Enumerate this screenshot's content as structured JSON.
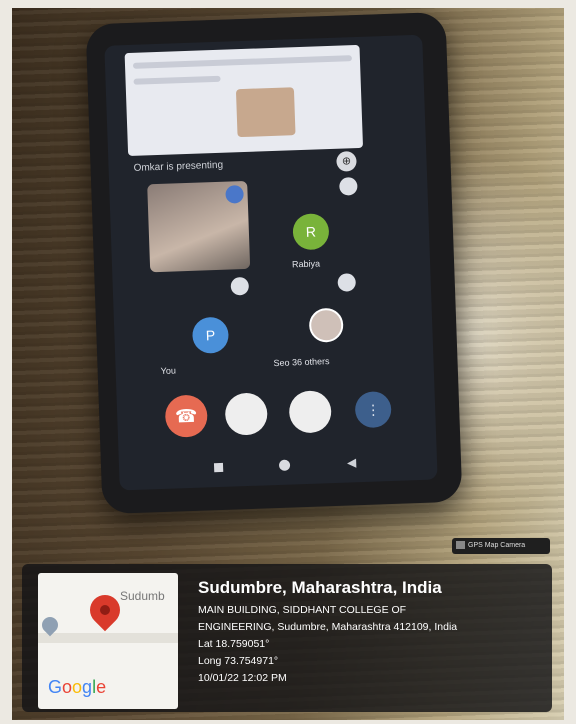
{
  "call_screen": {
    "presenting_text": "Omkar is presenting",
    "participants": [
      {
        "initial": "R",
        "name": "Rabiya"
      },
      {
        "initial": "P",
        "name": "You"
      },
      {
        "initial": "",
        "name": "Seo 36 others"
      }
    ],
    "colors": {
      "end_call": "#e66a52",
      "rabiya_avatar": "#79b33a",
      "you_avatar": "#4a90d9"
    }
  },
  "gps_overlay": {
    "badge_text": "GPS Map Camera",
    "map": {
      "place_label": "Sudumb",
      "brand": "Google"
    },
    "location_title": "Sudumbre, Maharashtra, India",
    "address_line1": "MAIN BUILDING, SIDDHANT COLLEGE OF",
    "address_line2": "ENGINEERING, Sudumbre, Maharashtra 412109, India",
    "latitude": "Lat 18.759051°",
    "longitude": "Long 73.754971°",
    "datetime": "10/01/22 12:02 PM"
  }
}
